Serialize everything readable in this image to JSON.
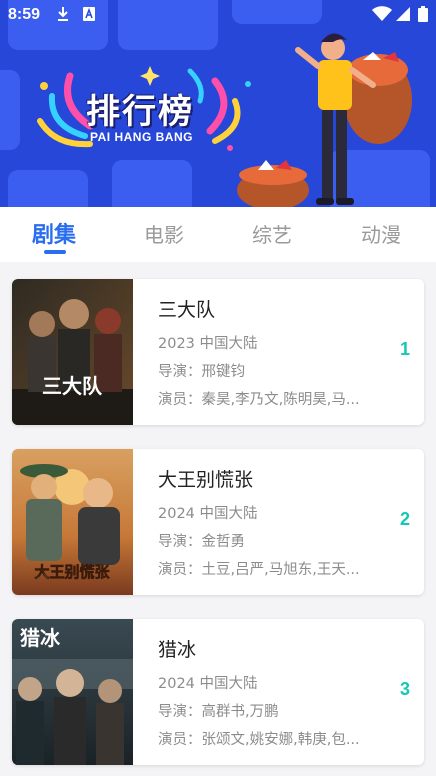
{
  "status_bar": {
    "time": "8:59",
    "icons": [
      "download-icon",
      "a-icon",
      "wifi-icon",
      "signal-icon",
      "battery-icon"
    ]
  },
  "banner": {
    "title": "排行榜",
    "subtitle": "PAI HANG BANG",
    "background_color": "#2747d8"
  },
  "tabs": [
    {
      "label": "剧集",
      "active": true
    },
    {
      "label": "电影",
      "active": false
    },
    {
      "label": "综艺",
      "active": false
    },
    {
      "label": "动漫",
      "active": false
    }
  ],
  "accent_color": "#2a6ef0",
  "rank_color": "#17c7b4",
  "items": [
    {
      "title": "三大队",
      "meta": "2023 中国大陆",
      "director": "导演：邢键钧",
      "cast": "演员：秦昊,李乃文,陈明昊,马...",
      "rank": "1",
      "poster_text": "三大队"
    },
    {
      "title": "大王别慌张",
      "meta": "2024 中国大陆",
      "director": "导演：金哲勇",
      "cast": "演员：土豆,吕严,马旭东,王天...",
      "rank": "2",
      "poster_text": "大王别慌张"
    },
    {
      "title": "猎冰",
      "meta": "2024 中国大陆",
      "director": "导演：高群书,万鹏",
      "cast": "演员：张颂文,姚安娜,韩庚,包...",
      "rank": "3",
      "poster_text": "猎冰"
    }
  ]
}
